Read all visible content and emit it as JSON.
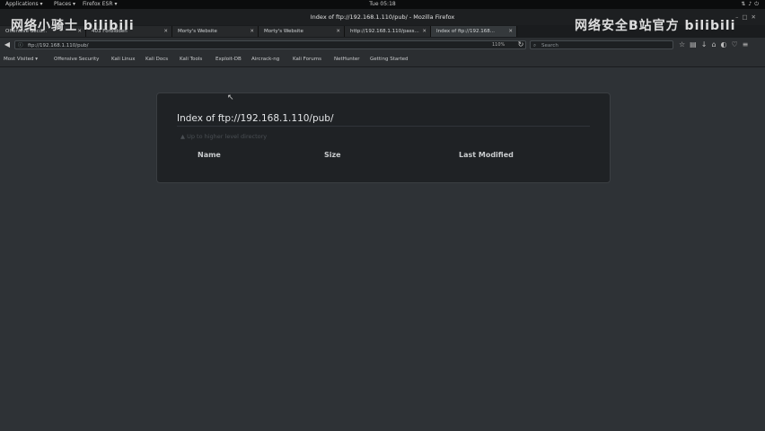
{
  "system_bar": {
    "applications": "Applications ▾",
    "places": "Places ▾",
    "firefox_esr": "Firefox ESR ▾",
    "clock": "Tue 05:18",
    "tray_icons": [
      "network-icon",
      "volume-icon",
      "power-icon"
    ]
  },
  "window": {
    "title": "Index of ftp://192.168.1.110/pub/ - Mozilla Firefox"
  },
  "tabs": [
    {
      "label": "Offensive Secu...",
      "active": false
    },
    {
      "label": "403 Forbidden",
      "active": false
    },
    {
      "label": "Morty's Website",
      "active": false
    },
    {
      "label": "Morty's Website",
      "active": false
    },
    {
      "label": "http://192.168.1.110/pass...",
      "active": false
    },
    {
      "label": "Index of ftp://192.168...",
      "active": true
    }
  ],
  "navbar": {
    "url": "ftp://192.168.1.110/pub/",
    "zoom": "110%",
    "search_placeholder": "Search"
  },
  "bookmarks": [
    "Most Visited ▾",
    "Offensive Security",
    "Kali Linux",
    "Kali Docs",
    "Kali Tools",
    "Exploit-DB",
    "Aircrack-ng",
    "Kali Forums",
    "NetHunter",
    "Getting Started"
  ],
  "watermarks": {
    "left": "网络小骑士 bilibili",
    "right": "网络安全B站官方 bilibili"
  },
  "listing": {
    "heading": "Index of ftp://192.168.1.110/pub/",
    "parent_link": "Up to higher level directory",
    "columns": {
      "name": "Name",
      "size": "Size",
      "last_modified": "Last Modified"
    }
  },
  "colors": {
    "page_bg": "#2e3236",
    "panel_bg": "#1f2225",
    "chrome_dark": "#0b0c0d"
  }
}
